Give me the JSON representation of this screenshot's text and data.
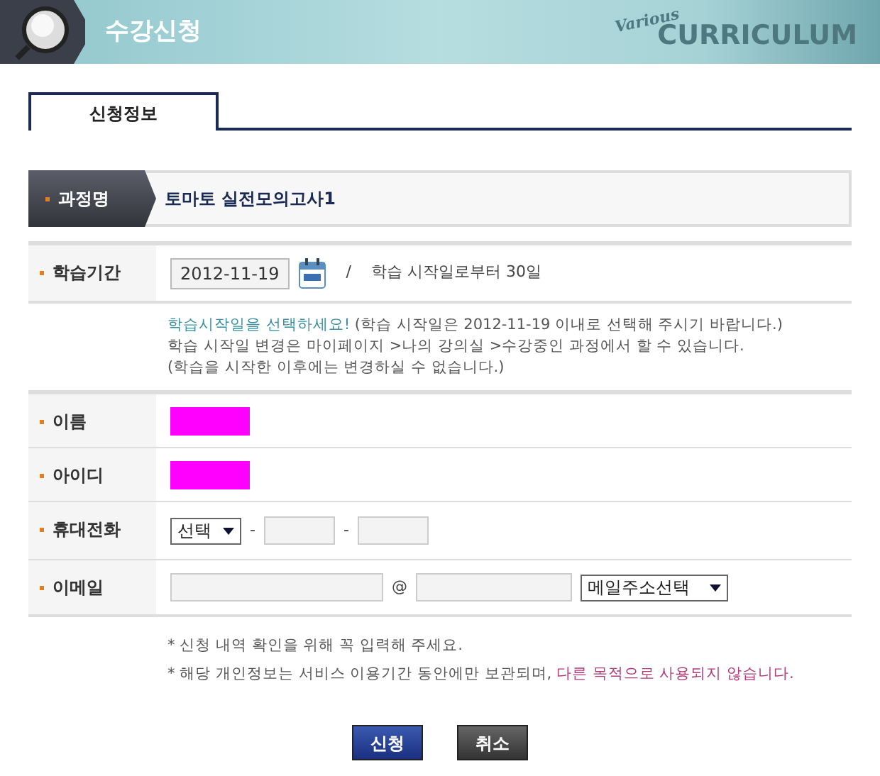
{
  "header": {
    "title": "수강신청",
    "logo_script": "Various",
    "logo": "CURRICULUM"
  },
  "tabs": [
    {
      "label": "신청정보",
      "selected": true
    }
  ],
  "course": {
    "label": "과정명",
    "value": "토마토 실전모의고사1"
  },
  "period": {
    "label": "학습기간",
    "date": "2012-11-19",
    "separator": "/",
    "duration": "학습 시작일로부터 30일"
  },
  "notes": [
    [
      {
        "text": "학습시작일을 선택하세요!",
        "emphasis": true
      },
      {
        "text": " (학습 시작일은 2012-11-19 이내로 선택해 주시기 바랍니다.)",
        "emphasis": false
      }
    ],
    [
      {
        "text": "학습 시작일 변경은 마이페이지 >나의 강의실 >수강중인 과정에서 할 수 있습니다.",
        "emphasis": false
      }
    ],
    [
      {
        "text": "(학습을 시작한 이후에는 변경하실 수 없습니다.)",
        "emphasis": false
      }
    ]
  ],
  "fields": [
    {
      "kind": "redacted",
      "label": "이름"
    },
    {
      "kind": "redacted",
      "label": "아이디"
    },
    {
      "kind": "phone",
      "label": "휴대전화",
      "select": "선택",
      "separators": [
        "-",
        "-"
      ]
    },
    {
      "kind": "email",
      "label": "이메일",
      "at": "@",
      "select": "메일주소선택"
    }
  ],
  "footnotes": [
    [
      {
        "text": "* 신청 내역 확인을 위해 꼭 입력해 주세요.",
        "emphasis": false
      }
    ],
    [
      {
        "text": "* 해당 개인정보는 서비스 이용기간 동안에만 보관되며, ",
        "emphasis": false
      },
      {
        "text": "다른 목적으로 사용되지 않습니다.",
        "emphasis": true
      }
    ]
  ],
  "buttons": [
    {
      "label": "신청",
      "kind": "primary"
    },
    {
      "label": "취소",
      "kind": "secondary"
    }
  ]
}
